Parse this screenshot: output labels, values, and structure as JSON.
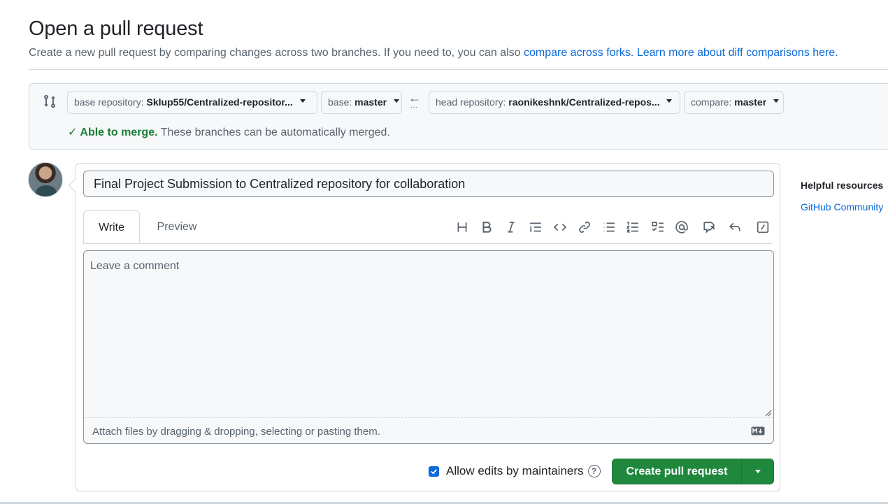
{
  "header": {
    "title": "Open a pull request",
    "subtitle": "Create a new pull request by comparing changes across two branches. If you need to, you can also",
    "link_forks": "compare across forks.",
    "link_learn": "Learn more about diff comparisons here."
  },
  "compare": {
    "base_repo_label": "base repository:",
    "base_repo_value": "Sklup55/Centralized-repositor...",
    "base_label": "base:",
    "base_value": "master",
    "head_repo_label": "head repository:",
    "head_repo_value": "raonikeshnk/Centralized-repos...",
    "compare_label": "compare:",
    "compare_value": "master",
    "merge_ok": "Able to merge.",
    "merge_text": "These branches can be automatically merged."
  },
  "form": {
    "title_value": "Final Project Submission to Centralized repository for collaboration",
    "tab_write": "Write",
    "tab_preview": "Preview",
    "comment_placeholder": "Leave a comment",
    "attach_text": "Attach files by dragging & dropping, selecting or pasting them.",
    "allow_edits": "Allow edits by maintainers",
    "allow_edits_checked": true,
    "create_label": "Create pull request",
    "toolbar_icons": [
      "heading-icon",
      "bold-icon",
      "italic-icon",
      "quote-icon",
      "code-icon",
      "link-icon",
      "unordered-list-icon",
      "ordered-list-icon",
      "task-list-icon",
      "mention-icon",
      "cross-reference-icon",
      "reply-icon",
      "slash-command-icon"
    ]
  },
  "sidebar": {
    "helpful_title": "Helpful resources",
    "community_link": "GitHub Community"
  },
  "colors": {
    "accent": "#0969da",
    "success": "#1a7f37",
    "button_green": "#1f883d"
  }
}
